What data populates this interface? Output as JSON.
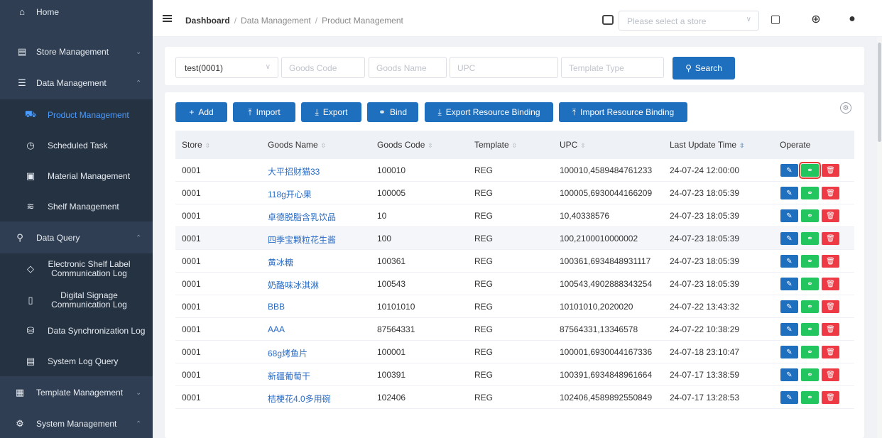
{
  "sidebar": {
    "items": [
      {
        "label": "Home",
        "icon": "home-icon"
      },
      {
        "label": "Store Management",
        "icon": "store-icon"
      },
      {
        "label": "Data Management",
        "icon": "database-icon"
      },
      {
        "label": "Product Management",
        "icon": "cart-icon"
      },
      {
        "label": "Scheduled Task",
        "icon": "clock-icon"
      },
      {
        "label": "Material Management",
        "icon": "image-icon"
      },
      {
        "label": "Shelf Management",
        "icon": "layers-icon"
      },
      {
        "label": "Data Query",
        "icon": "search-icon"
      },
      {
        "label": "Electronic Shelf Label Communication Log",
        "icon": "tag-icon"
      },
      {
        "label": "Digital Signage Communication Log",
        "icon": "tablet-icon"
      },
      {
        "label": "Data Synchronization Log",
        "icon": "sync-icon"
      },
      {
        "label": "System Log Query",
        "icon": "document-icon"
      },
      {
        "label": "Template Management",
        "icon": "template-icon"
      },
      {
        "label": "System Management",
        "icon": "gear-icon"
      }
    ]
  },
  "header": {
    "breadcrumb": [
      "Dashboard",
      "Data Management",
      "Product Management"
    ],
    "store_placeholder": "Please select a store"
  },
  "filters": {
    "store_value": "test(0001)",
    "goods_code_placeholder": "Goods Code",
    "goods_name_placeholder": "Goods Name",
    "upc_placeholder": "UPC",
    "template_type_placeholder": "Template Type",
    "search_label": "Search"
  },
  "toolbar": {
    "add": "Add",
    "import": "Import",
    "export": "Export",
    "bind": "Bind",
    "export_binding": "Export Resource Binding",
    "import_binding": "Import Resource Binding"
  },
  "table": {
    "columns": [
      "Store",
      "Goods Name",
      "Goods Code",
      "Template",
      "UPC",
      "Last Update Time",
      "Operate"
    ],
    "rows": [
      {
        "store": "0001",
        "name": "大平招财猫33",
        "code": "100010",
        "template": "REG",
        "upc": "100010,4589484761233",
        "time": "24-07-24 12:00:00"
      },
      {
        "store": "0001",
        "name": "118g开心果",
        "code": "100005",
        "template": "REG",
        "upc": "100005,6930044166209",
        "time": "24-07-23 18:05:39"
      },
      {
        "store": "0001",
        "name": "卓德脱脂含乳饮品",
        "code": "10",
        "template": "REG",
        "upc": "10,40338576",
        "time": "24-07-23 18:05:39"
      },
      {
        "store": "0001",
        "name": "四季宝颗粒花生酱",
        "code": "100",
        "template": "REG",
        "upc": "100,2100010000002",
        "time": "24-07-23 18:05:39"
      },
      {
        "store": "0001",
        "name": "黄冰糖",
        "code": "100361",
        "template": "REG",
        "upc": "100361,6934848931117",
        "time": "24-07-23 18:05:39"
      },
      {
        "store": "0001",
        "name": "奶酪味冰淇淋",
        "code": "100543",
        "template": "REG",
        "upc": "100543,4902888343254",
        "time": "24-07-23 18:05:39"
      },
      {
        "store": "0001",
        "name": "BBB",
        "code": "10101010",
        "template": "REG",
        "upc": "10101010,2020020",
        "time": "24-07-22 13:43:32"
      },
      {
        "store": "0001",
        "name": "AAA",
        "code": "87564331",
        "template": "REG",
        "upc": "87564331,13346578",
        "time": "24-07-22 10:38:29"
      },
      {
        "store": "0001",
        "name": "68g烤鱼片",
        "code": "100001",
        "template": "REG",
        "upc": "100001,6930044167336",
        "time": "24-07-18 23:10:47"
      },
      {
        "store": "0001",
        "name": "新疆葡萄干",
        "code": "100391",
        "template": "REG",
        "upc": "100391,6934848961664",
        "time": "24-07-17 13:38:59"
      },
      {
        "store": "0001",
        "name": "桔梗花4.0多用碗",
        "code": "102406",
        "template": "REG",
        "upc": "102406,4589892550849",
        "time": "24-07-17 13:28:53"
      }
    ]
  },
  "colors": {
    "primary": "#1f6fbf",
    "success": "#22c55e",
    "danger": "#ee3a45",
    "sidebar": "#2f3e52"
  }
}
